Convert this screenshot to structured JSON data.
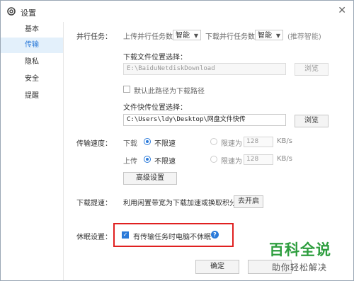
{
  "window": {
    "title": "设置",
    "close_glyph": "✕"
  },
  "sidebar": {
    "items": [
      {
        "label": "基本",
        "active": false
      },
      {
        "label": "传输",
        "active": true
      },
      {
        "label": "隐私",
        "active": false
      },
      {
        "label": "安全",
        "active": false
      },
      {
        "label": "提醒",
        "active": false
      }
    ]
  },
  "parallel": {
    "label": "并行任务：",
    "upload_label": "上传并行任务数",
    "upload_value": "智能",
    "download_label": "下载并行任务数",
    "download_value": "智能",
    "hint": "(推荐智能)"
  },
  "download_location": {
    "label": "下载文件位置选择：",
    "path": "E:\\BaiduNetdiskDownload",
    "browse": "浏览",
    "default_checkbox": "默认此路径为下载路径",
    "default_checked": false
  },
  "express_location": {
    "label": "文件快传位置选择：",
    "path": "C:\\Users\\ldy\\Desktop\\网盘文件快传",
    "browse": "浏览"
  },
  "speed": {
    "label": "传输速度：",
    "download": {
      "label": "下载",
      "unlimited": "不限速",
      "limit": "限速为",
      "value": "128",
      "unit": "KB/s"
    },
    "upload": {
      "label": "上传",
      "unlimited": "不限速",
      "limit": "限速为",
      "value": "128",
      "unit": "KB/s"
    },
    "advanced": "高级设置"
  },
  "boost": {
    "label": "下载提速：",
    "text": "利用闲置带宽为下载加速或换取积分",
    "button": "去开启"
  },
  "sleep": {
    "label": "休眠设置：",
    "checkbox": "有传输任务时电脑不休眠",
    "checked": true,
    "help": "?"
  },
  "footer": {
    "ok": "确定"
  },
  "watermark": {
    "line1": "百科全说",
    "line2": "助你轻松解决"
  },
  "colors": {
    "accent": "#2b7ad9",
    "highlight": "#e02020",
    "watermark": "#2e9e3f"
  }
}
